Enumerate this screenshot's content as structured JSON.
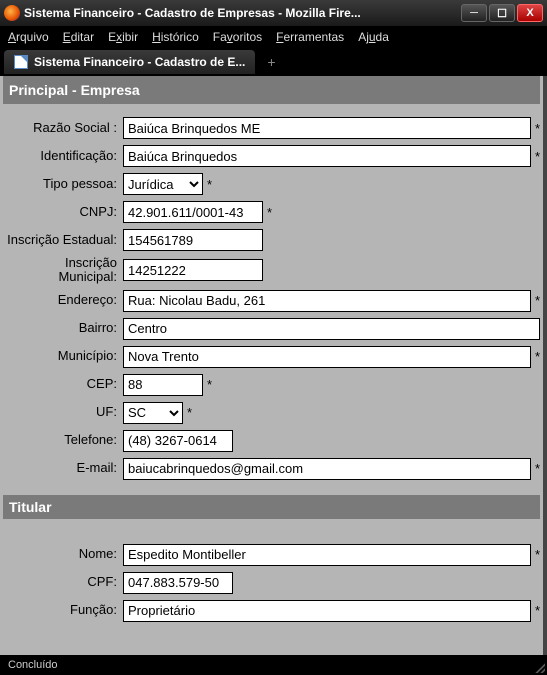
{
  "window": {
    "title": "Sistema Financeiro - Cadastro de Empresas - Mozilla Fire..."
  },
  "menu": {
    "arquivo": "Arquivo",
    "editar": "Editar",
    "exibir": "Exibir",
    "historico": "Histórico",
    "favoritos": "Favoritos",
    "ferramentas": "Ferramentas",
    "ajuda": "Ajuda"
  },
  "tab": {
    "label": "Sistema Financeiro - Cadastro de E..."
  },
  "sections": {
    "principal": "Principal  -  Empresa",
    "titular": "Titular"
  },
  "labels": {
    "razao_social": "Razão Social :",
    "identificacao": "Identificação:",
    "tipo_pessoa": "Tipo pessoa:",
    "cnpj": "CNPJ:",
    "inscricao_estadual": "Inscrição Estadual:",
    "inscricao_municipal": "Inscrição Municipal:",
    "endereco": "Endereço:",
    "bairro": "Bairro:",
    "municipio": "Município:",
    "cep": "CEP:",
    "uf": "UF:",
    "telefone": "Telefone:",
    "email": "E-mail:",
    "nome": "Nome:",
    "cpf": "CPF:",
    "funcao": "Função:"
  },
  "values": {
    "razao_social": "Baiúca Brinquedos ME",
    "identificacao": "Baiúca Brinquedos",
    "tipo_pessoa": "Jurídica",
    "cnpj": "42.901.611/0001-43",
    "inscricao_estadual": "154561789",
    "inscricao_municipal": "14251222",
    "endereco": "Rua: Nicolau Badu, 261",
    "bairro": "Centro",
    "municipio": "Nova Trento",
    "cep": "88",
    "uf": "SC",
    "telefone": "(48) 3267-0614",
    "email": "baiucabrinquedos@gmail.com",
    "nome": "Espedito Montibeller",
    "cpf": "047.883.579-50",
    "funcao": "Proprietário"
  },
  "asterisk": "*",
  "status": {
    "text": "Concluído"
  }
}
